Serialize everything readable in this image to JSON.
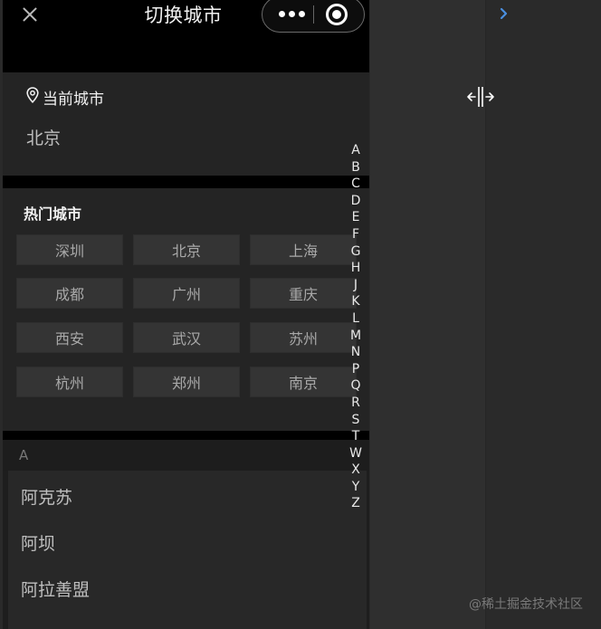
{
  "nav": {
    "title": "切换城市"
  },
  "current": {
    "label": "当前城市",
    "city": "北京"
  },
  "hot": {
    "label": "热门城市",
    "cities": [
      "深圳",
      "北京",
      "上海",
      "成都",
      "广州",
      "重庆",
      "西安",
      "武汉",
      "苏州",
      "杭州",
      "郑州",
      "南京"
    ]
  },
  "section_a": {
    "letter": "A",
    "cities": [
      "阿克苏",
      "阿坝",
      "阿拉善盟"
    ]
  },
  "index_letters": [
    "A",
    "B",
    "C",
    "D",
    "E",
    "F",
    "G",
    "H",
    "J",
    "K",
    "L",
    "M",
    "N",
    "P",
    "Q",
    "R",
    "S",
    "T",
    "W",
    "X",
    "Y",
    "Z"
  ],
  "watermark": "@稀土掘金技术社区",
  "icons": {
    "close": "close-icon",
    "more": "more-dots-icon",
    "home": "home-target-icon",
    "location": "location-pin-icon",
    "chevron": "chevron-right-icon",
    "resize": "resize-cursor-icon"
  },
  "colors": {
    "background": "#1e1e1e",
    "nav": "#000000",
    "button": "#343434",
    "chevron": "#4a8fe0"
  }
}
